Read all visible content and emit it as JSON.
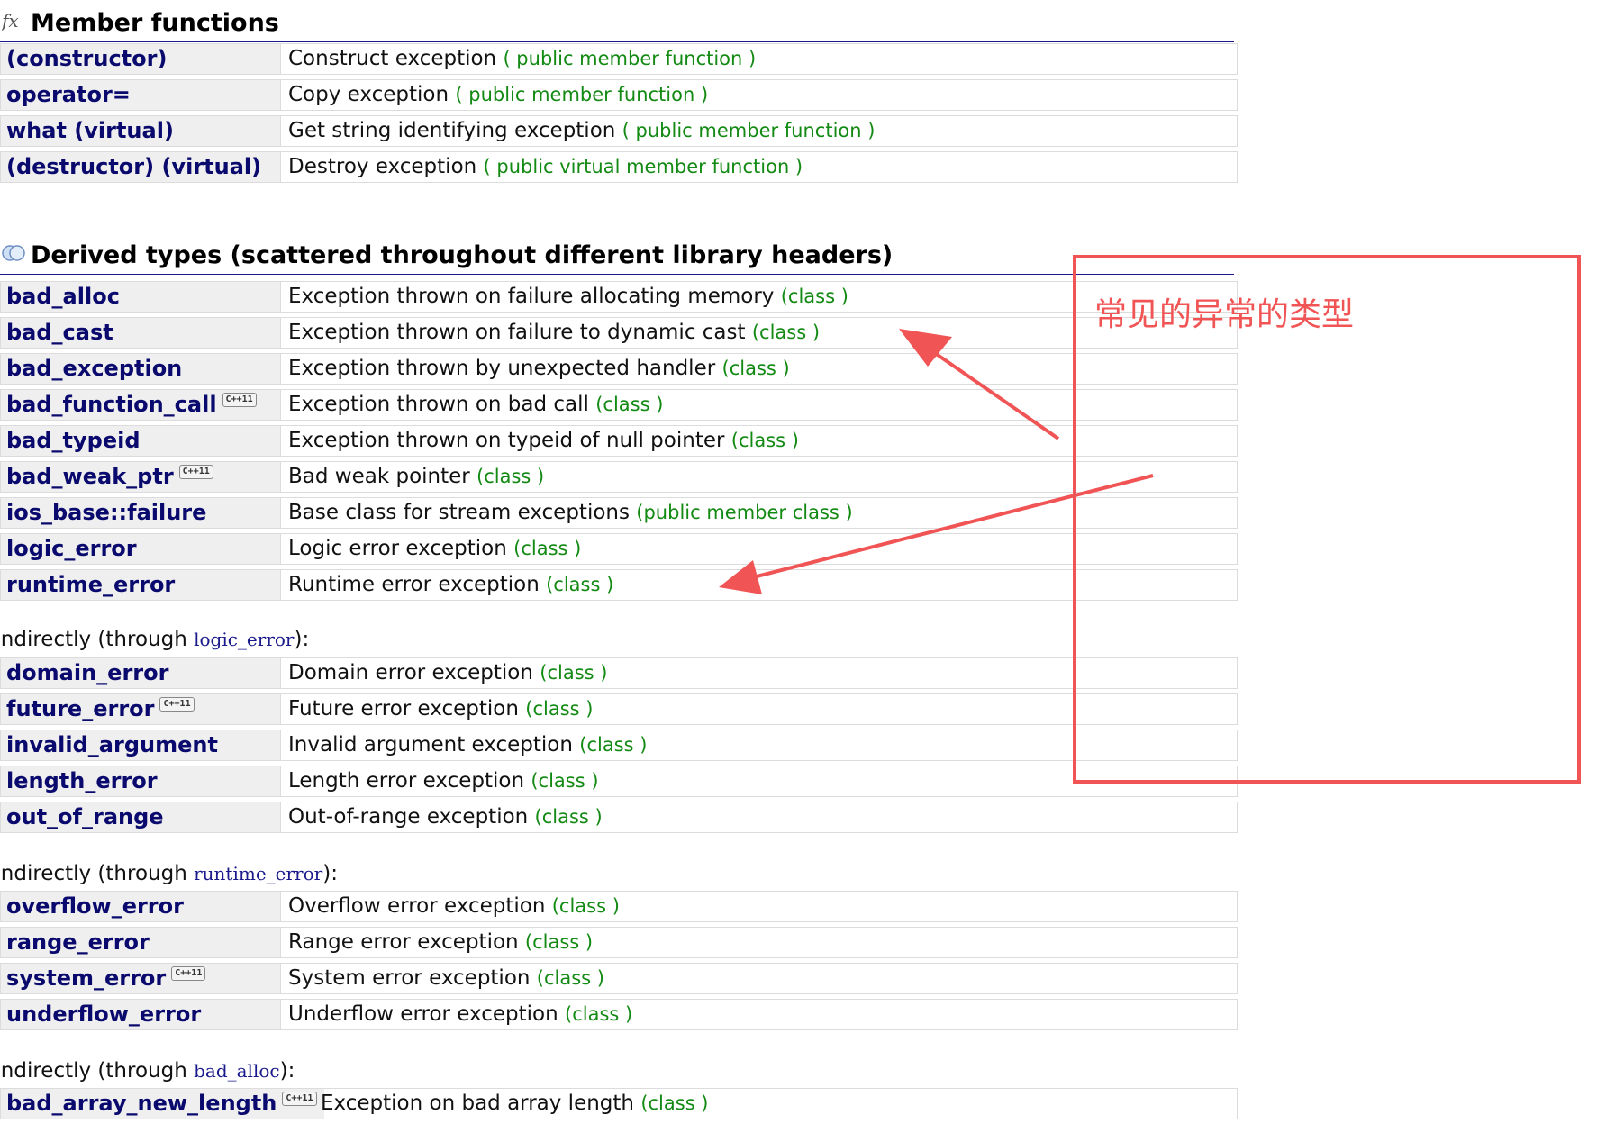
{
  "member_functions": {
    "title": "Member functions",
    "rows": [
      {
        "name": "(constructor)",
        "desc": "Construct exception",
        "kind": "( public member function )"
      },
      {
        "name": "operator=",
        "desc": "Copy exception",
        "kind": "( public member function )"
      },
      {
        "name": "what (virtual)",
        "desc": "Get string identifying exception",
        "kind": "( public member function )"
      },
      {
        "name": "(destructor) (virtual)",
        "desc": "Destroy exception",
        "kind": "( public virtual member function )"
      }
    ]
  },
  "derived_types": {
    "title": "Derived types (scattered throughout different library headers)",
    "rows": [
      {
        "name": "bad_alloc",
        "desc": "Exception thrown on failure allocating memory",
        "kind": "(class )"
      },
      {
        "name": "bad_cast",
        "desc": "Exception thrown on failure to dynamic cast",
        "kind": "(class )"
      },
      {
        "name": "bad_exception",
        "desc": "Exception thrown by unexpected handler",
        "kind": "(class )"
      },
      {
        "name": "bad_function_call",
        "badge": "C++11",
        "desc": "Exception thrown on bad call",
        "kind": "(class )"
      },
      {
        "name": "bad_typeid",
        "desc": "Exception thrown on typeid of null pointer",
        "kind": "(class )"
      },
      {
        "name": "bad_weak_ptr",
        "badge": "C++11",
        "desc": "Bad weak pointer",
        "kind": "(class )"
      },
      {
        "name": "ios_base::failure",
        "desc": "Base class for stream exceptions",
        "kind": "(public member class )"
      },
      {
        "name": "logic_error",
        "desc": "Logic error exception",
        "kind": "(class )"
      },
      {
        "name": "runtime_error",
        "desc": "Runtime error exception",
        "kind": "(class )"
      }
    ]
  },
  "indirect_logic": {
    "prefix": "Indirectly (through ",
    "code": "logic_error",
    "suffix": "):",
    "rows": [
      {
        "name": "domain_error",
        "desc": "Domain error exception",
        "kind": "(class )"
      },
      {
        "name": "future_error",
        "badge": "C++11",
        "desc": "Future error exception",
        "kind": "(class )"
      },
      {
        "name": "invalid_argument",
        "desc": "Invalid argument exception",
        "kind": "(class )"
      },
      {
        "name": "length_error",
        "desc": "Length error exception",
        "kind": "(class )"
      },
      {
        "name": "out_of_range",
        "desc": "Out-of-range exception",
        "kind": "(class )"
      }
    ]
  },
  "indirect_runtime": {
    "prefix": "Indirectly (through ",
    "code": "runtime_error",
    "suffix": "):",
    "rows": [
      {
        "name": "overflow_error",
        "desc": "Overflow error exception",
        "kind": "(class )"
      },
      {
        "name": "range_error",
        "desc": "Range error exception",
        "kind": "(class )"
      },
      {
        "name": "system_error",
        "badge": "C++11",
        "desc": "System error exception",
        "kind": "(class )"
      },
      {
        "name": "underflow_error",
        "desc": "Underflow error exception",
        "kind": "(class )"
      }
    ]
  },
  "indirect_bad_alloc": {
    "prefix": "Indirectly (through ",
    "code": "bad_alloc",
    "suffix": "):",
    "rows": [
      {
        "name": "bad_array_new_length",
        "badge": "C++11",
        "desc": "Exception on bad array length",
        "kind": "(class )"
      }
    ]
  },
  "annotation": {
    "text": "常见的异常的类型",
    "color": "#f05454"
  },
  "colors": {
    "name": "#0a0a6e",
    "kind": "#138a13",
    "header_rule": "#1a1a8c"
  }
}
